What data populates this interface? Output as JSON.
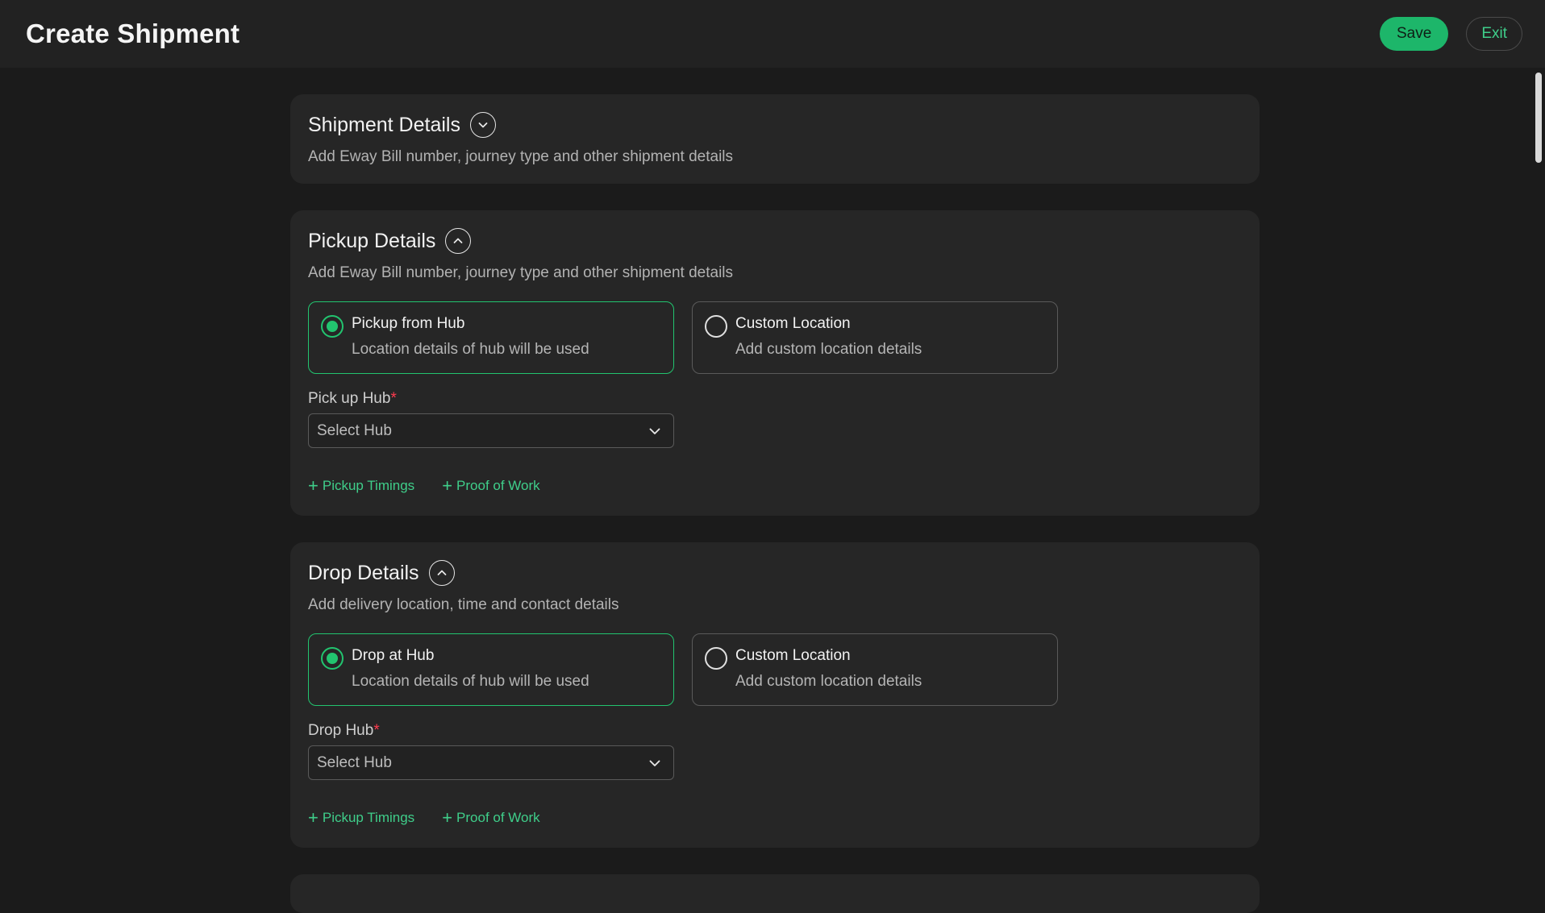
{
  "header": {
    "title": "Create Shipment",
    "save_label": "Save",
    "exit_label": "Exit"
  },
  "sections": {
    "shipment": {
      "title": "Shipment Details",
      "subtitle": "Add Eway Bill number, journey type and other shipment details",
      "state": "collapsed"
    },
    "pickup": {
      "title": "Pickup Details",
      "subtitle": "Add Eway Bill number, journey type and other shipment details",
      "state": "expanded",
      "options": [
        {
          "title": "Pickup from Hub",
          "desc": "Location details of hub will be used",
          "selected": true
        },
        {
          "title": "Custom Location",
          "desc": "Add custom location details",
          "selected": false
        }
      ],
      "field_label": "Pick up Hub",
      "required_mark": "*",
      "select_value": "Select Hub",
      "links": [
        "Pickup Timings",
        "Proof of Work"
      ]
    },
    "drop": {
      "title": "Drop Details",
      "subtitle": "Add delivery location, time and contact details",
      "state": "expanded",
      "options": [
        {
          "title": "Drop at Hub",
          "desc": "Location details of hub will be used",
          "selected": true
        },
        {
          "title": "Custom Location",
          "desc": "Add custom location details",
          "selected": false
        }
      ],
      "field_label": "Drop Hub",
      "required_mark": "*",
      "select_value": "Select Hub",
      "links": [
        "Pickup Timings",
        "Proof of Work"
      ]
    }
  },
  "colors": {
    "accent": "#22c46f",
    "save_bg": "#1db66a",
    "required": "#ff3b4f",
    "background": "#1b1b1b",
    "card": "#262626"
  },
  "icons": {
    "collapsed": "chevron-down-icon",
    "expanded": "chevron-up-icon",
    "select": "chevron-down-icon",
    "link": "plus-icon"
  }
}
